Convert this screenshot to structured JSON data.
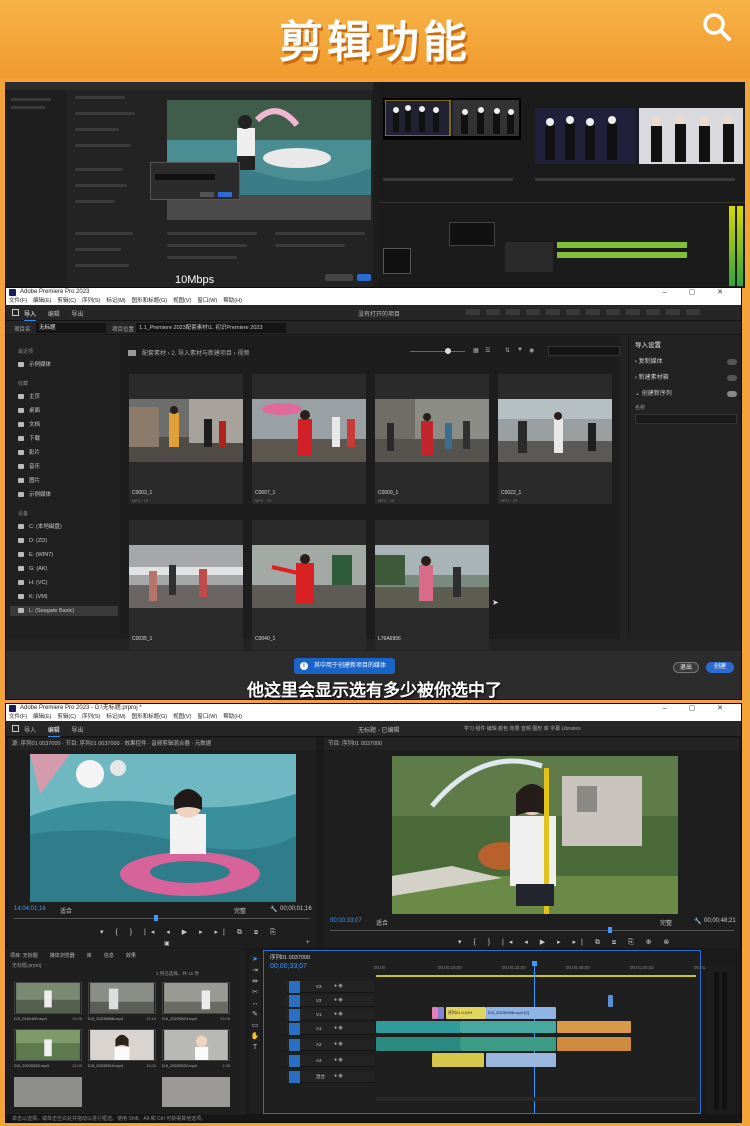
{
  "banner": {
    "title": "剪辑功能",
    "icon": "search-icon"
  },
  "strip": {
    "caption": "10Mbps"
  },
  "import_window": {
    "title": "Adobe Premiere Pro 2023",
    "menu": [
      "文件(F)",
      "编辑(E)",
      "剪辑(C)",
      "序列(S)",
      "标记(M)",
      "图形和标题(G)",
      "视图(V)",
      "窗口(W)",
      "帮助(H)"
    ],
    "tabs": [
      "导入",
      "编辑",
      "导出"
    ],
    "header_center": "没有打开的项目",
    "project_label": "项目名",
    "project_value": "无标题",
    "location_label": "项目位置",
    "location_value": "1.1_Premiere 2023配套素材\\1. 初识Premiere 2023",
    "sidebar": {
      "recent_heading": "最近项",
      "recent": [
        {
          "label": "示例媒体",
          "icon": "star-icon"
        }
      ],
      "favorites_heading": "收藏",
      "favorites": [
        {
          "label": "主页",
          "icon": "home-icon"
        },
        {
          "label": "桌面",
          "icon": "desktop-icon"
        },
        {
          "label": "文档",
          "icon": "document-icon"
        },
        {
          "label": "下载",
          "icon": "download-icon"
        },
        {
          "label": "影片",
          "icon": "film-icon"
        },
        {
          "label": "音乐",
          "icon": "music-icon"
        },
        {
          "label": "图片",
          "icon": "image-icon"
        },
        {
          "label": "示例媒体",
          "icon": "folder-icon"
        }
      ],
      "devices_heading": "设备",
      "devices": [
        {
          "label": "C: (本地磁盘)"
        },
        {
          "label": "D: (ZD)"
        },
        {
          "label": "E: (WIN7)"
        },
        {
          "label": "G: (AK)"
        },
        {
          "label": "H: (VC)"
        },
        {
          "label": "K: (VM)"
        },
        {
          "label": "L: (Seagate Basic)",
          "selected": true
        }
      ]
    },
    "breadcrumb": "配套素材 › 2. 导入素材与新建项目 › 视频",
    "media": [
      {
        "name": "C0003_1",
        "meta": "MP4 · 15"
      },
      {
        "name": "C0007_1",
        "meta": "MP4 · 15"
      },
      {
        "name": "C0009_1",
        "meta": "MP4 · 15"
      },
      {
        "name": "C0022_1",
        "meta": "MP4 · 29"
      },
      {
        "name": "C0035_1",
        "meta": ""
      },
      {
        "name": "C0040_1",
        "meta": ""
      },
      {
        "name": "L76A6956",
        "meta": ""
      }
    ],
    "import_settings": {
      "title": "导入设置",
      "options": [
        "复制媒体",
        "新建素材箱",
        "创建新序列"
      ],
      "name_label": "名称"
    },
    "notice": "其中用于创建新项目的媒体",
    "subtitle": "他这里会显示选有多少被你选中了",
    "cancel": "退出",
    "create": "创建"
  },
  "edit_window": {
    "title": "Adobe Premiere Pro 2023 - G:\\无标题.prproj *",
    "menu": [
      "文件(F)",
      "编辑(E)",
      "剪辑(C)",
      "序列(S)",
      "标记(M)",
      "图形和标题(G)",
      "视图(V)",
      "窗口(W)",
      "帮助(H)"
    ],
    "tabs": [
      "导入",
      "编辑",
      "导出"
    ],
    "center_title": "无标题 - 已编辑",
    "workspaces": "学习 组件 编辑 颜色 效果 音频 图形 库 字幕 Libraries",
    "source_header": "源: 序列01 0037000 · 节目: 序列01 0037000 · 效果控件 · 音频剪辑混合器 · 元数据",
    "program_header": "节目: 序列01 0037000",
    "source_tc": "14;04;01;16",
    "source_zoom": "适合",
    "source_full": "完整",
    "source_dur": "00;00;01;16",
    "program_tc": "00;00;33;07",
    "program_zoom": "适合",
    "program_full": "完整",
    "program_dur": "00;00;48;21",
    "project_tabs": [
      "项目: 无标题",
      "媒体浏览器",
      "库",
      "信息",
      "效果"
    ],
    "project_name": "无标题.prproj",
    "project_count": "1 项已选择，共 16 项",
    "clips": [
      {
        "name": "DJI_0181480.mp4",
        "dur": "19:06"
      },
      {
        "name": "DJI_20230808.mp4",
        "dur": "12:16"
      },
      {
        "name": "DJI_20220824.mp4",
        "dur": "13:06"
      },
      {
        "name": "DJI_20220822.mp4",
        "dur": "12:03"
      },
      {
        "name": "DJI_20230510.mp4",
        "dur": "12:06"
      },
      {
        "name": "DJI_20220522.mp4",
        "dur": "1:08"
      }
    ],
    "timeline_header": "序列01 0037000",
    "timeline_tc": "00;00;33;07",
    "ruler": [
      "00;00",
      "00;00;16;00",
      "00;00;32;00",
      "00;00;48;00",
      "00;01;04;02",
      "00;01;20;02"
    ],
    "track_labels": [
      "V3",
      "V2",
      "V1",
      "A1",
      "A2",
      "A3",
      "混合"
    ],
    "clip_labels": [
      "序列01 0;02H",
      "DJI_20230908.mp4 [V]"
    ],
    "status": "单击以选择，或单击空白处并拖动以进行框选。使用 Shift、Alt 和 Ctrl 可获得其他选项。"
  }
}
